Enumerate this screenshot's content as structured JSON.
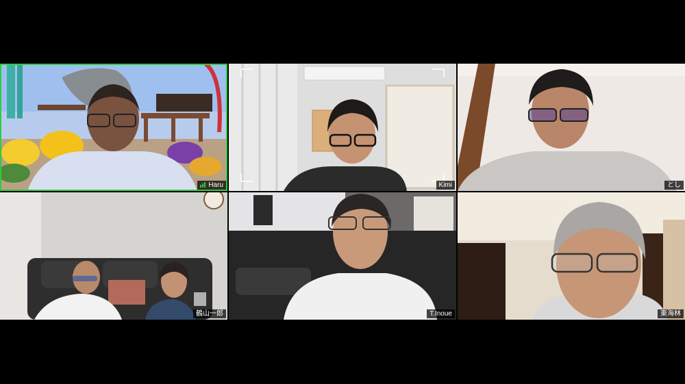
{
  "meeting": {
    "participants": [
      {
        "name": "Haru",
        "speaking": true
      },
      {
        "name": "Kimi",
        "speaking": false
      },
      {
        "name": "とし",
        "speaking": false
      },
      {
        "name": "鶴山一郎",
        "speaking": false
      },
      {
        "name": "T.Inoue",
        "speaking": false
      },
      {
        "name": "東海林",
        "speaking": false
      }
    ]
  },
  "colors": {
    "active_speaker_border": "#2ecc40",
    "background": "#000000",
    "name_tag_bg": "#000000"
  },
  "icons": {
    "active_speaker_indicator": "mic-level-icon"
  }
}
